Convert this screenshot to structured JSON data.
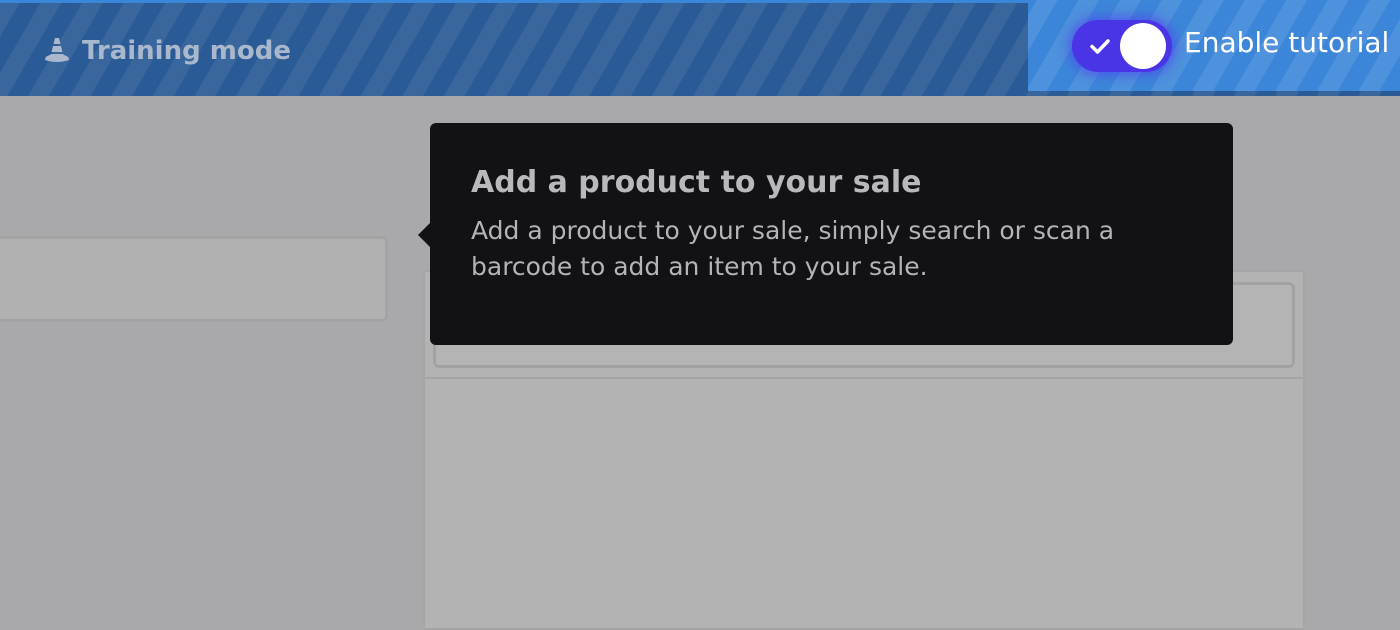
{
  "banner": {
    "title": "Training mode",
    "icon": "traffic-cone-icon"
  },
  "tutorial_toggle": {
    "label": "Enable tutorial",
    "enabled": true,
    "icon": "checkmark-icon",
    "track_color": "#4a35e6"
  },
  "tooltip": {
    "title": "Add a product to your sale",
    "body": "Add a product to your sale, simply search or scan a barcode to add an item to your sale."
  },
  "colors": {
    "banner": "#2a5b96",
    "tutorial_panel": "#3c86d9",
    "tooltip_bg": "#111116",
    "overlay": "#a9a8aa"
  }
}
